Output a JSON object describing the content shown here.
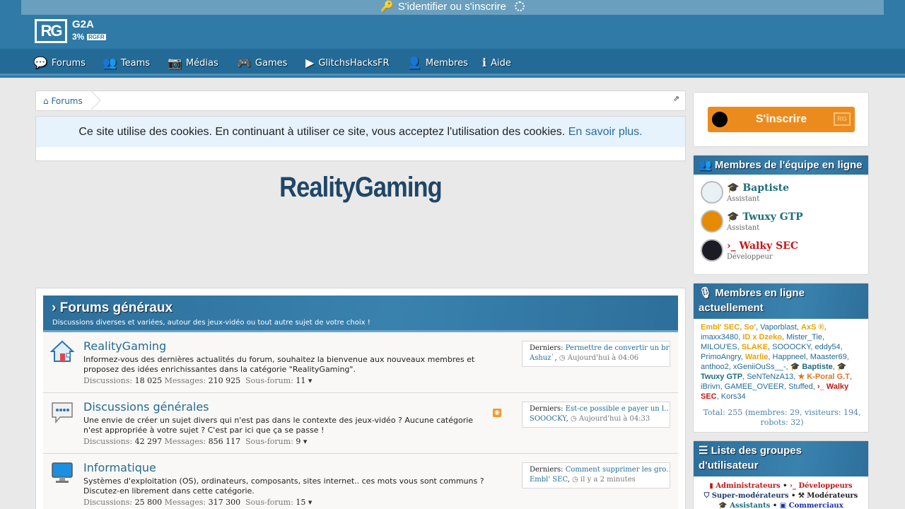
{
  "login_bar": {
    "label": "S'identifier ou s'inscrire"
  },
  "logo": {
    "brand": "RG",
    "partner": "G2A",
    "discount": "3%",
    "code": "RGFR"
  },
  "nav": [
    {
      "label": "Forums",
      "icon": "comments-icon"
    },
    {
      "label": "Teams",
      "icon": "users-icon"
    },
    {
      "label": "Médias",
      "icon": "camera-icon"
    },
    {
      "label": "Games",
      "icon": "gamepad-icon"
    },
    {
      "label": "GlitchsHacksFR",
      "icon": "youtube-play-icon"
    },
    {
      "label": "Membres",
      "icon": "user-icon"
    },
    {
      "label": "Aide",
      "icon": "info-icon"
    }
  ],
  "breadcrumb": {
    "home": "Forums"
  },
  "cookie": {
    "text": "Ce site utilise des cookies. En continuant à utiliser ce site, vous acceptez l'utilisation des cookies.",
    "link": "En savoir plus."
  },
  "site_title": "RealityGaming",
  "category": {
    "title": "Forums généraux",
    "description": "Discussions diverses et variées, autour des jeux-vidéo ou tout autre sujet de votre choix !"
  },
  "forums": [
    {
      "name": "RealityGaming",
      "description": "Informez-vous des dernières actualités du forum, souhaitez la bienvenue aux nouveaux membres et proposez des idées enrichissantes dans la catégorie \"RealityGaming\".",
      "discussions_label": "Discussions:",
      "discussions": "18 025",
      "messages_label": "Messages:",
      "messages": "210 925",
      "sub_label": "Sous-forum:",
      "sub": "11",
      "last_label": "Derniers:",
      "last_title": "Permettre de convertir un br…",
      "last_user": "Ashuz`",
      "last_time": "Aujourd'hui à 04:06"
    },
    {
      "name": "Discussions générales",
      "description": "Une envie de créer un sujet divers qui n'est pas dans le contexte des jeux-vidéo ? Aucune catégorie n'est appropriée à votre sujet ? C'est par ici que ça se passe !",
      "discussions_label": "Discussions:",
      "discussions": "42 297",
      "messages_label": "Messages:",
      "messages": "856 117",
      "sub_label": "Sous-forum:",
      "sub": "9",
      "last_label": "Derniers:",
      "last_title": "Est-ce possible e payer un l…",
      "last_user": "SOOOCKY",
      "last_time": "Aujourd'hui à 04:33"
    },
    {
      "name": "Informatique",
      "description": "Systèmes d'exploitation (OS), ordinateurs, composants, sites internet.. ces mots vous sont communs ? Discutez-en librement dans cette catégorie.",
      "discussions_label": "Discussions:",
      "discussions": "25 800",
      "messages_label": "Messages:",
      "messages": "317 300",
      "sub_label": "Sous-forum:",
      "sub": "15",
      "last_label": "Derniers:",
      "last_title": "Comment supprimer les gro…",
      "last_user": "Embl' SEC",
      "last_time": "il y a 2 minutes"
    }
  ],
  "sidebar": {
    "signup": "S'inscrire",
    "staff_title": "Membres de l'équipe en ligne",
    "staff": [
      {
        "name": "Baptiste",
        "role": "Assistant",
        "color": "#1d6e7a",
        "avatar_color": "#e8f1f6"
      },
      {
        "name": "Twuxy GTP",
        "role": "Assistant",
        "color": "#1d6e7a",
        "avatar_color": "#e68a00"
      },
      {
        "name": "Walky SEC",
        "role": "Développeur",
        "color": "#c0181a",
        "avatar_color": "#1b1b28"
      }
    ],
    "online_title": "Membres en ligne actuellement",
    "online_members": [
      {
        "name": "Embl' SEC",
        "cls": "gold"
      },
      {
        "name": "So'",
        "cls": "gold"
      },
      {
        "name": "Vaporblast",
        "cls": ""
      },
      {
        "name": "AxS ®",
        "cls": "gold"
      },
      {
        "name": "imaxx3480",
        "cls": ""
      },
      {
        "name": "ID x Dzeko",
        "cls": "gold"
      },
      {
        "name": "Mister_Tie",
        "cls": ""
      },
      {
        "name": "MILOU'ES",
        "cls": ""
      },
      {
        "name": "SLAKE",
        "cls": "gold"
      },
      {
        "name": "SOOOCKY",
        "cls": ""
      },
      {
        "name": "eddy54",
        "cls": ""
      },
      {
        "name": "PrimoAngry",
        "cls": ""
      },
      {
        "name": "Warlie",
        "cls": "gold"
      },
      {
        "name": "Happneel",
        "cls": ""
      },
      {
        "name": "Maaster69",
        "cls": ""
      },
      {
        "name": "anthoo2",
        "cls": ""
      },
      {
        "name": "xGeniiOuSs__-",
        "cls": ""
      },
      {
        "name": "Baptiste",
        "cls": "teal"
      },
      {
        "name": "Twuxy GTP",
        "cls": "teal"
      },
      {
        "name": "SeNTeNzA13",
        "cls": ""
      },
      {
        "name": "K-Poral G.T",
        "cls": "orange"
      },
      {
        "name": "iBrivn",
        "cls": ""
      },
      {
        "name": "GAMEE_OVEER",
        "cls": ""
      },
      {
        "name": "Stuffed",
        "cls": ""
      },
      {
        "name": "Walky SEC",
        "cls": "red"
      },
      {
        "name": "Kors34",
        "cls": ""
      }
    ],
    "online_total": "Total: 255 (membres: 29, visiteurs: 194, robots: 32)",
    "groups_title": "Liste des groupes d'utilisateur",
    "groups": [
      {
        "name": "Administrateurs",
        "color": "#c0181a"
      },
      {
        "name": "Développeurs",
        "color": "#c0181a"
      },
      {
        "name": "Super-modérateurs",
        "color": "#1e3a6e"
      },
      {
        "name": "Modérateurs",
        "color": "#222222"
      },
      {
        "name": "Assistants",
        "color": "#1d6e7a"
      },
      {
        "name": "Commerciaux",
        "color": "#1a2fb0"
      }
    ]
  }
}
